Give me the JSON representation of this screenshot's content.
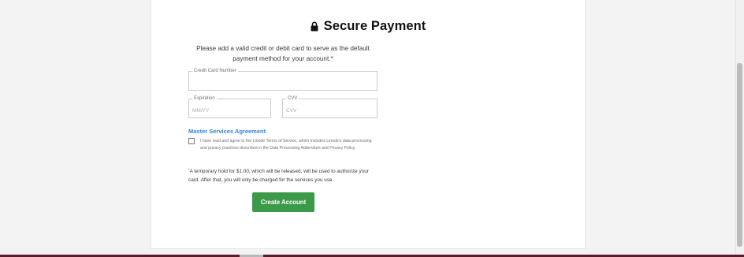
{
  "header": {
    "title": "Secure Payment",
    "lock_icon": "lock-icon"
  },
  "intro": "Please add a valid credit or debit card to serve as the default payment method for your account.*",
  "form": {
    "card_number": {
      "label": "Credit Card Number",
      "value": "",
      "placeholder": ""
    },
    "expiration": {
      "label": "Expiration",
      "value": "",
      "placeholder": "MM/YY"
    },
    "cvv": {
      "label": "CVV",
      "value": "",
      "placeholder": "CVV"
    }
  },
  "agreement": {
    "link_label": "Master Services Agreement",
    "checked": false,
    "text": "I have read and agree to the Linode Terms of Service, which includes Linode's data processing and privacy practices described in the Data Processing Addendum and Privacy Policy."
  },
  "hold_note": {
    "marker": "*",
    "text": "A temporary hold for $1.00, which will be released, will be used to authorize your card. After that, you will only be charged for the services you use."
  },
  "actions": {
    "create_account_label": "Create Account"
  },
  "colors": {
    "primary_button": "#3b9a48",
    "link": "#3683dc",
    "bottom_bar": "#5a1c28"
  }
}
